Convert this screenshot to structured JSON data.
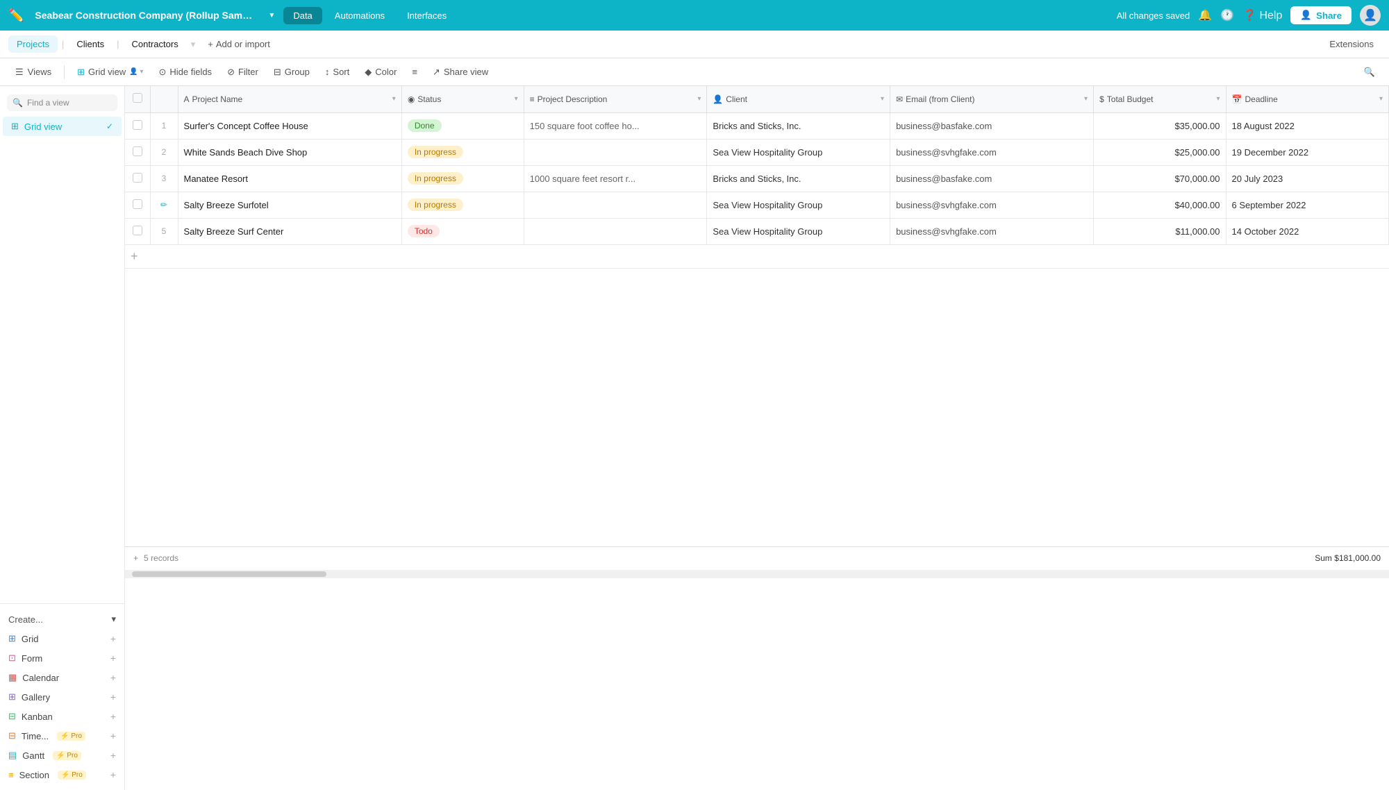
{
  "app": {
    "title": "Seabear Construction Company (Rollup Sampl...",
    "dropdown_arrow": "▼",
    "status": "All changes saved"
  },
  "top_nav": {
    "icon": "✏️",
    "tabs": [
      {
        "id": "data",
        "label": "Data",
        "active": true
      },
      {
        "id": "automations",
        "label": "Automations",
        "active": false
      },
      {
        "id": "interfaces",
        "label": "Interfaces",
        "active": false
      }
    ],
    "right": {
      "status": "All changes saved",
      "help": "Help",
      "share": "Share"
    }
  },
  "second_nav": {
    "tabs": [
      {
        "id": "projects",
        "label": "Projects",
        "active": true
      },
      {
        "id": "clients",
        "label": "Clients",
        "active": false
      },
      {
        "id": "contractors",
        "label": "Contractors",
        "active": false
      }
    ],
    "add_label": "Add or import",
    "extensions_label": "Extensions"
  },
  "toolbar": {
    "views_label": "Views",
    "grid_view_label": "Grid view",
    "hide_fields_label": "Hide fields",
    "filter_label": "Filter",
    "group_label": "Group",
    "sort_label": "Sort",
    "color_label": "Color",
    "density_label": "",
    "share_view_label": "Share view"
  },
  "sidebar": {
    "search_placeholder": "Find a view",
    "views": [
      {
        "id": "grid",
        "label": "Grid view",
        "active": true
      }
    ],
    "create_label": "Create...",
    "create_items": [
      {
        "id": "grid",
        "label": "Grid",
        "icon": "grid",
        "pro": false
      },
      {
        "id": "form",
        "label": "Form",
        "icon": "form",
        "pro": false
      },
      {
        "id": "calendar",
        "label": "Calendar",
        "icon": "calendar",
        "pro": false
      },
      {
        "id": "gallery",
        "label": "Gallery",
        "icon": "gallery",
        "pro": false
      },
      {
        "id": "kanban",
        "label": "Kanban",
        "icon": "kanban",
        "pro": false
      },
      {
        "id": "timeline",
        "label": "Time...",
        "icon": "timeline",
        "pro": true
      },
      {
        "id": "gantt",
        "label": "Gantt",
        "icon": "gantt",
        "pro": true
      },
      {
        "id": "section",
        "label": "Section",
        "icon": "section",
        "pro": true
      }
    ]
  },
  "columns": [
    {
      "id": "name",
      "label": "Project Name",
      "icon": "A"
    },
    {
      "id": "status",
      "label": "Status",
      "icon": "◉"
    },
    {
      "id": "description",
      "label": "Project Description",
      "icon": "≡"
    },
    {
      "id": "client",
      "label": "Client",
      "icon": "👤"
    },
    {
      "id": "email",
      "label": "Email (from Client)",
      "icon": "✉"
    },
    {
      "id": "budget",
      "label": "Total Budget",
      "icon": "$"
    },
    {
      "id": "deadline",
      "label": "Deadline",
      "icon": "📅"
    }
  ],
  "rows": [
    {
      "num": "1",
      "name": "Surfer's Concept Coffee House",
      "status": "Done",
      "status_type": "done",
      "description": "150 square foot coffee ho...",
      "client": "Bricks and Sticks, Inc.",
      "email": "business@basfake.com",
      "budget": "$35,000.00",
      "deadline": "18 August 2022",
      "pencil": false
    },
    {
      "num": "2",
      "name": "White Sands Beach Dive Shop",
      "status": "In progress",
      "status_type": "inprogress",
      "description": "",
      "client": "Sea View Hospitality Group",
      "email": "business@svhgfake.com",
      "budget": "$25,000.00",
      "deadline": "19 December 2022",
      "pencil": false
    },
    {
      "num": "3",
      "name": "Manatee Resort",
      "status": "In progress",
      "status_type": "inprogress",
      "description": "1000 square feet resort r...",
      "client": "Bricks and Sticks, Inc.",
      "email": "business@basfake.com",
      "budget": "$70,000.00",
      "deadline": "20 July 2023",
      "pencil": false
    },
    {
      "num": "",
      "name": "Salty Breeze Surfotel",
      "status": "In progress",
      "status_type": "inprogress",
      "description": "",
      "client": "Sea View Hospitality Group",
      "email": "business@svhgfake.com",
      "budget": "$40,000.00",
      "deadline": "6 September 2022",
      "pencil": true
    },
    {
      "num": "5",
      "name": "Salty Breeze Surf Center",
      "status": "Todo",
      "status_type": "todo",
      "description": "",
      "client": "Sea View Hospitality Group",
      "email": "business@svhgfake.com",
      "budget": "$11,000.00",
      "deadline": "14 October 2022",
      "pencil": false
    }
  ],
  "footer": {
    "records": "5 records",
    "sum_label": "Sum",
    "sum_value": "$181,000.00"
  },
  "colors": {
    "primary": "#0db3c7",
    "header_bg": "#f8f9fa"
  }
}
